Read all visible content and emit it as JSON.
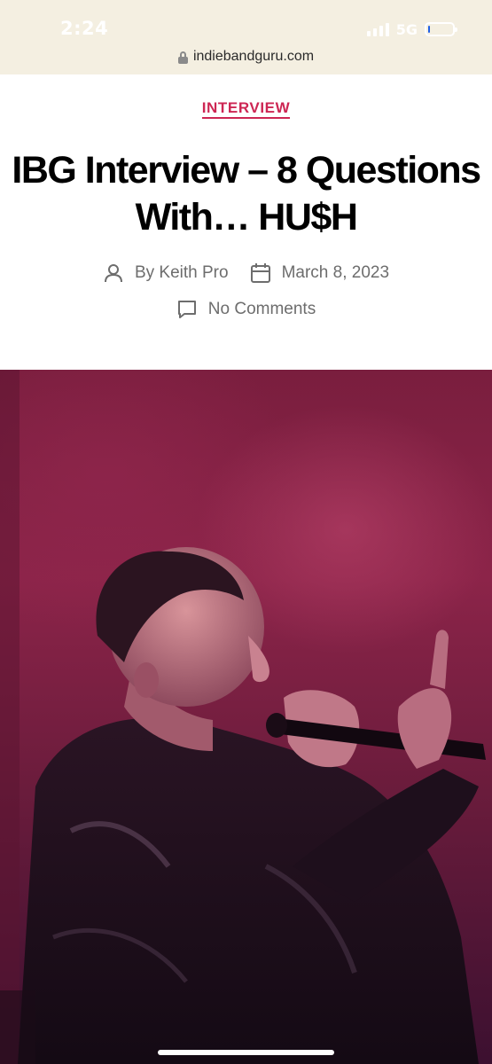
{
  "status_bar": {
    "time": "2:24",
    "network": "5G",
    "battery_level": 0.08
  },
  "browser": {
    "url": "indiebandguru.com"
  },
  "article": {
    "category": "INTERVIEW",
    "title": "IBG Interview – 8 Questions With… HU$H",
    "author": "By Keith Pro",
    "date": "March 8, 2023",
    "comments": "No Comments"
  },
  "icons": {
    "lock": "lock-icon",
    "author": "person-icon",
    "date": "calendar-icon",
    "comments": "comment-bubble-icon"
  },
  "colors": {
    "accent": "#cd2653",
    "status_bg": "#f4efe1",
    "meta_text": "#6d6d6d"
  }
}
